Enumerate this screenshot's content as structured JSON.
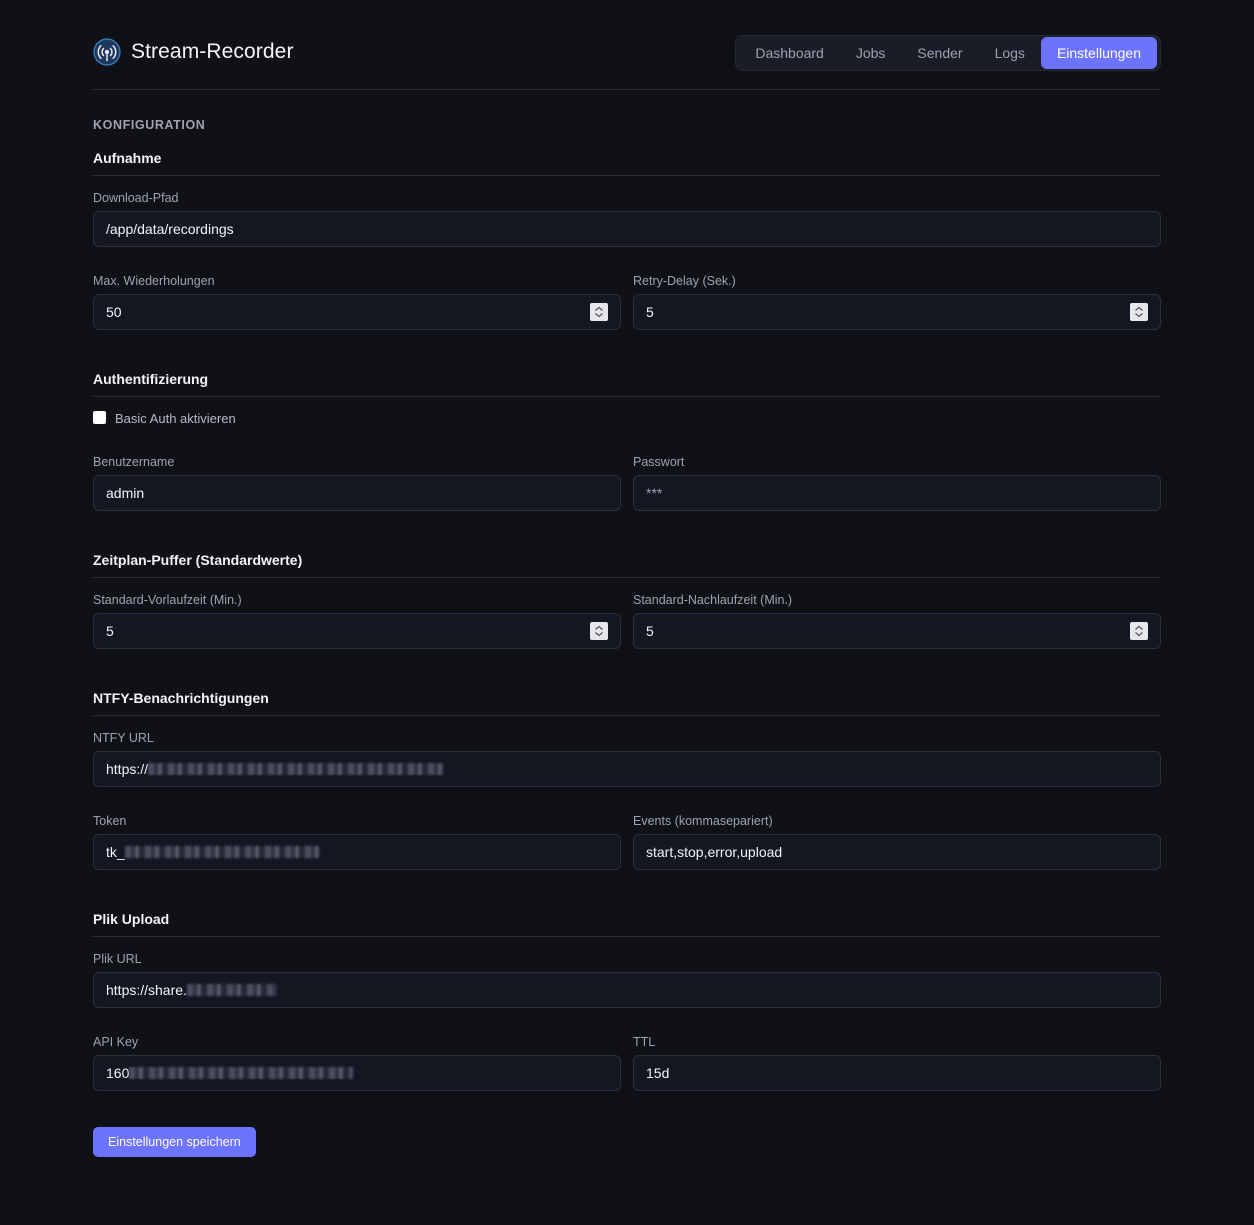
{
  "app": {
    "title": "Stream-Recorder"
  },
  "nav": {
    "items": [
      {
        "label": "Dashboard"
      },
      {
        "label": "Jobs"
      },
      {
        "label": "Sender"
      },
      {
        "label": "Logs"
      },
      {
        "label": "Einstellungen",
        "active": true
      }
    ]
  },
  "page": {
    "section_title": "KONFIGURATION"
  },
  "recording": {
    "title": "Aufnahme",
    "download_path": {
      "label": "Download-Pfad",
      "value": "/app/data/recordings"
    },
    "max_retries": {
      "label": "Max. Wiederholungen",
      "value": "50"
    },
    "retry_delay": {
      "label": "Retry-Delay (Sek.)",
      "value": "5"
    }
  },
  "auth": {
    "title": "Authentifizierung",
    "enable": {
      "label": "Basic Auth aktivieren",
      "checked": false
    },
    "username": {
      "label": "Benutzername",
      "value": "admin"
    },
    "password": {
      "label": "Passwort",
      "value": "***"
    }
  },
  "schedule": {
    "title": "Zeitplan-Puffer (Standardwerte)",
    "lead_time": {
      "label": "Standard-Vorlaufzeit (Min.)",
      "value": "5"
    },
    "follow_time": {
      "label": "Standard-Nachlaufzeit (Min.)",
      "value": "5"
    }
  },
  "ntfy": {
    "title": "NTFY-Benachrichtigungen",
    "url": {
      "label": "NTFY URL",
      "value_prefix": "https://"
    },
    "token": {
      "label": "Token",
      "value_prefix": "tk_"
    },
    "events": {
      "label": "Events (kommasepariert)",
      "value": "start,stop,error,upload"
    }
  },
  "plik": {
    "title": "Plik Upload",
    "url": {
      "label": "Plik URL",
      "value_prefix": "https://share."
    },
    "api_key": {
      "label": "API Key",
      "value_prefix": "160"
    },
    "ttl": {
      "label": "TTL",
      "value": "15d"
    }
  },
  "actions": {
    "save_label": "Einstellungen speichern"
  },
  "colors": {
    "accent": "#6c73ff",
    "background": "#0f1117",
    "field_bg": "#141722"
  },
  "icons": {
    "logo": "broadcast-icon",
    "spinner": "stepper-arrows-icon"
  }
}
